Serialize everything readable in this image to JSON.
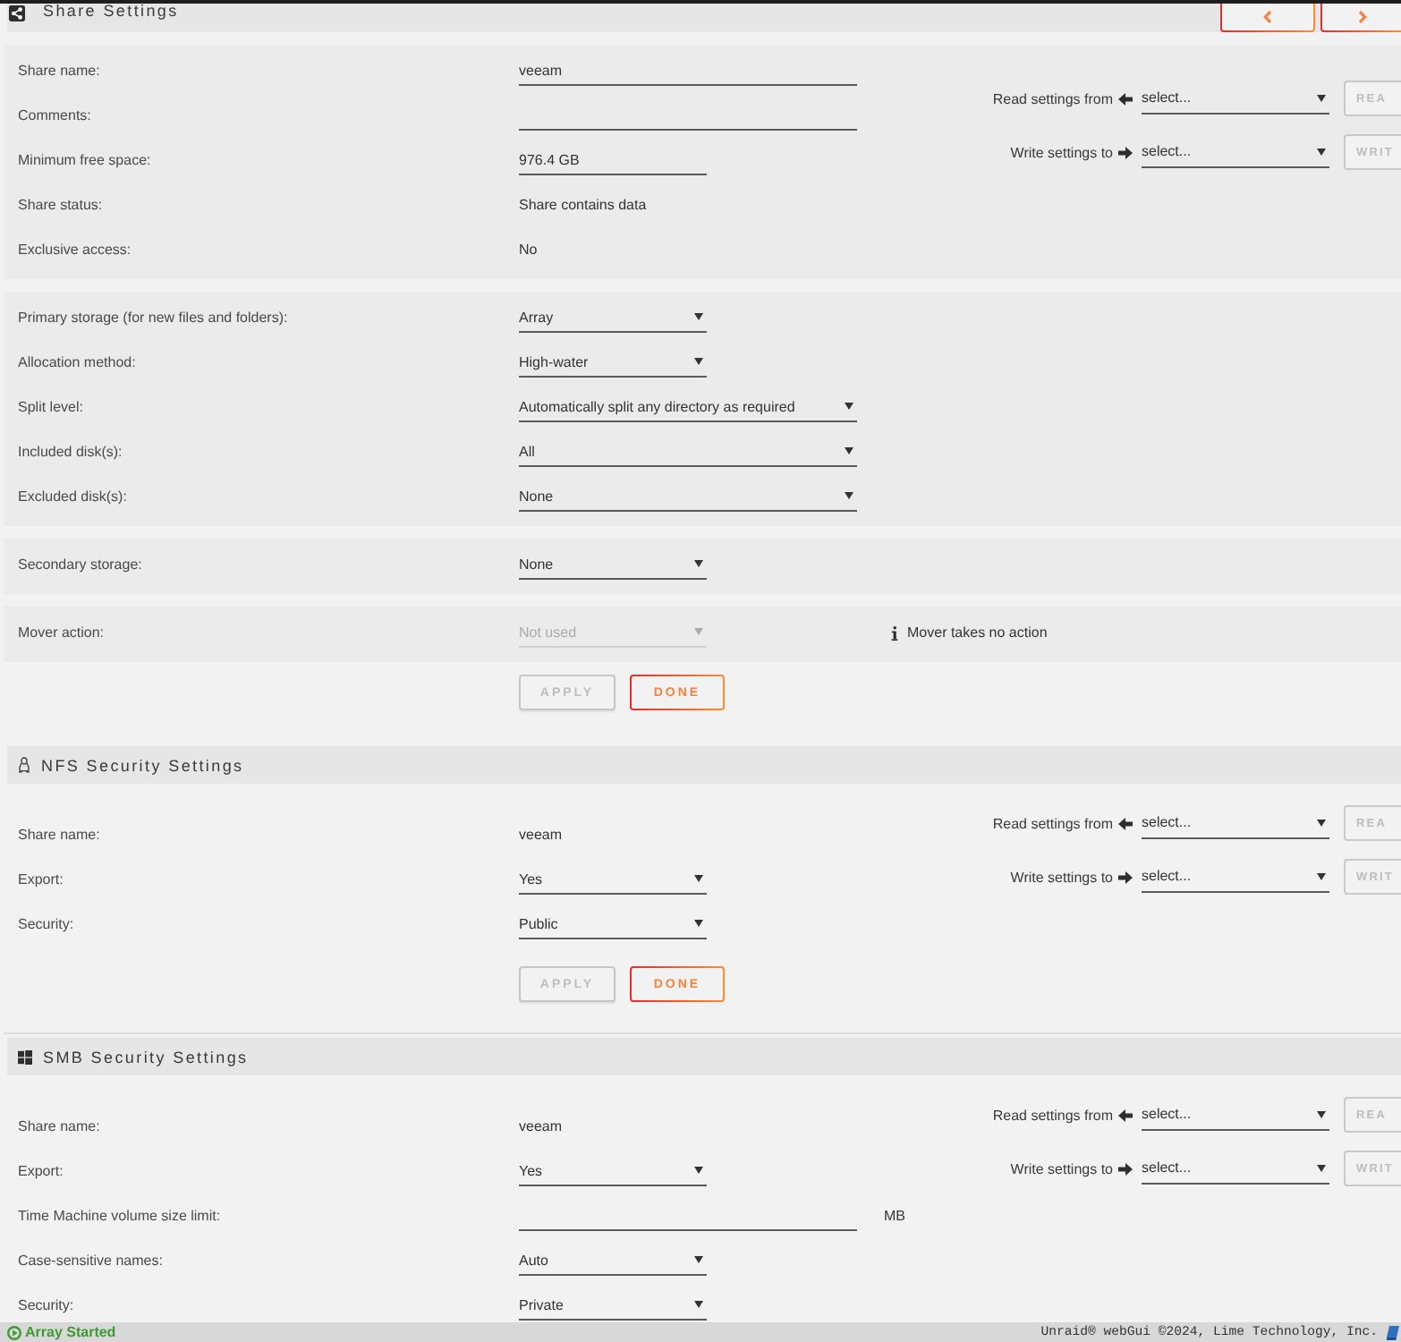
{
  "sections": [
    {
      "kind": "share",
      "title": "Share Settings",
      "groups": [
        {
          "rows": [
            {
              "label": "Share name:",
              "kind": "text_input",
              "value": "veeam",
              "disabled": false
            },
            {
              "label": "Comments:",
              "kind": "text_input",
              "disabled": false
            },
            {
              "label": "Minimum free space:",
              "kind": "size_input",
              "value": "976.4 GB",
              "disabled": false
            },
            {
              "label": "Share status:",
              "kind": "static",
              "value": "Share contains data",
              "disabled": false
            },
            {
              "label": "Exclusive access:",
              "kind": "static",
              "value": "No",
              "disabled": false
            }
          ],
          "copy_settings": [
            {
              "kind": "read",
              "label": "Read settings from",
              "value": "select...",
              "button": {
                "label": "REA",
                "disabled": true
              }
            },
            {
              "kind": "write",
              "label": "Write settings to",
              "value": "select...",
              "button": {
                "label": "WRIT",
                "disabled": true
              }
            }
          ]
        },
        {
          "rows": [
            {
              "label": "Primary storage (for new files and folders):",
              "kind": "select",
              "value": "Array",
              "disabled": false
            },
            {
              "label": "Allocation method:",
              "kind": "select",
              "value": "High-water",
              "disabled": false
            },
            {
              "label": "Split level:",
              "kind": "wide_select",
              "value": "Automatically split any directory as required",
              "disabled": false
            },
            {
              "label": "Included disk(s):",
              "kind": "wide_select",
              "value": "All",
              "disabled": false
            },
            {
              "label": "Excluded disk(s):",
              "kind": "wide_select",
              "value": "None",
              "disabled": false
            }
          ]
        },
        {
          "rows": [
            {
              "label": "Secondary storage:",
              "kind": "select",
              "value": "None",
              "disabled": false
            }
          ]
        },
        {
          "rows": [
            {
              "label": "Mover action:",
              "kind": "select",
              "value": "Not used",
              "disabled": true,
              "note": "Mover takes no action"
            }
          ]
        }
      ],
      "buttons": [
        {
          "label": "APPLY",
          "disabled": true
        },
        {
          "label": "DONE",
          "disabled": false
        }
      ]
    },
    {
      "kind": "nfs",
      "title": "NFS Security Settings",
      "groups": [
        {
          "rows": [
            {
              "label": "Share name:",
              "kind": "static",
              "value": "veeam",
              "disabled": false
            },
            {
              "label": "Export:",
              "kind": "select",
              "value": "Yes",
              "disabled": false
            },
            {
              "label": "Security:",
              "kind": "select",
              "value": "Public",
              "disabled": false
            }
          ],
          "copy_settings": [
            {
              "kind": "read",
              "label": "Read settings from",
              "value": "select...",
              "button": {
                "label": "REA",
                "disabled": true
              }
            },
            {
              "kind": "write",
              "label": "Write settings to",
              "value": "select...",
              "button": {
                "label": "WRIT",
                "disabled": true
              }
            }
          ]
        }
      ],
      "buttons": [
        {
          "label": "APPLY",
          "disabled": true
        },
        {
          "label": "DONE",
          "disabled": false
        }
      ]
    },
    {
      "kind": "smb",
      "title": "SMB Security Settings",
      "groups": [
        {
          "rows": [
            {
              "label": "Share name:",
              "kind": "static",
              "value": "veeam",
              "disabled": false
            },
            {
              "label": "Export:",
              "kind": "select",
              "value": "Yes",
              "disabled": false
            },
            {
              "label": "Time Machine volume size limit:",
              "kind": "text_input",
              "unit": "MB",
              "disabled": false
            },
            {
              "label": "Case-sensitive names:",
              "kind": "select",
              "value": "Auto",
              "disabled": false
            },
            {
              "label": "Security:",
              "kind": "select",
              "value": "Private",
              "disabled": false
            }
          ],
          "copy_settings": [
            {
              "kind": "read",
              "label": "Read settings from",
              "value": "select...",
              "button": {
                "label": "REA",
                "disabled": true
              }
            },
            {
              "kind": "write",
              "label": "Write settings to",
              "value": "select...",
              "button": {
                "label": "WRIT",
                "disabled": true
              }
            }
          ]
        }
      ]
    }
  ],
  "status_bar": {
    "status": "Array Started",
    "credit": "Unraid® webGui ©2024, Lime Technology, Inc."
  }
}
